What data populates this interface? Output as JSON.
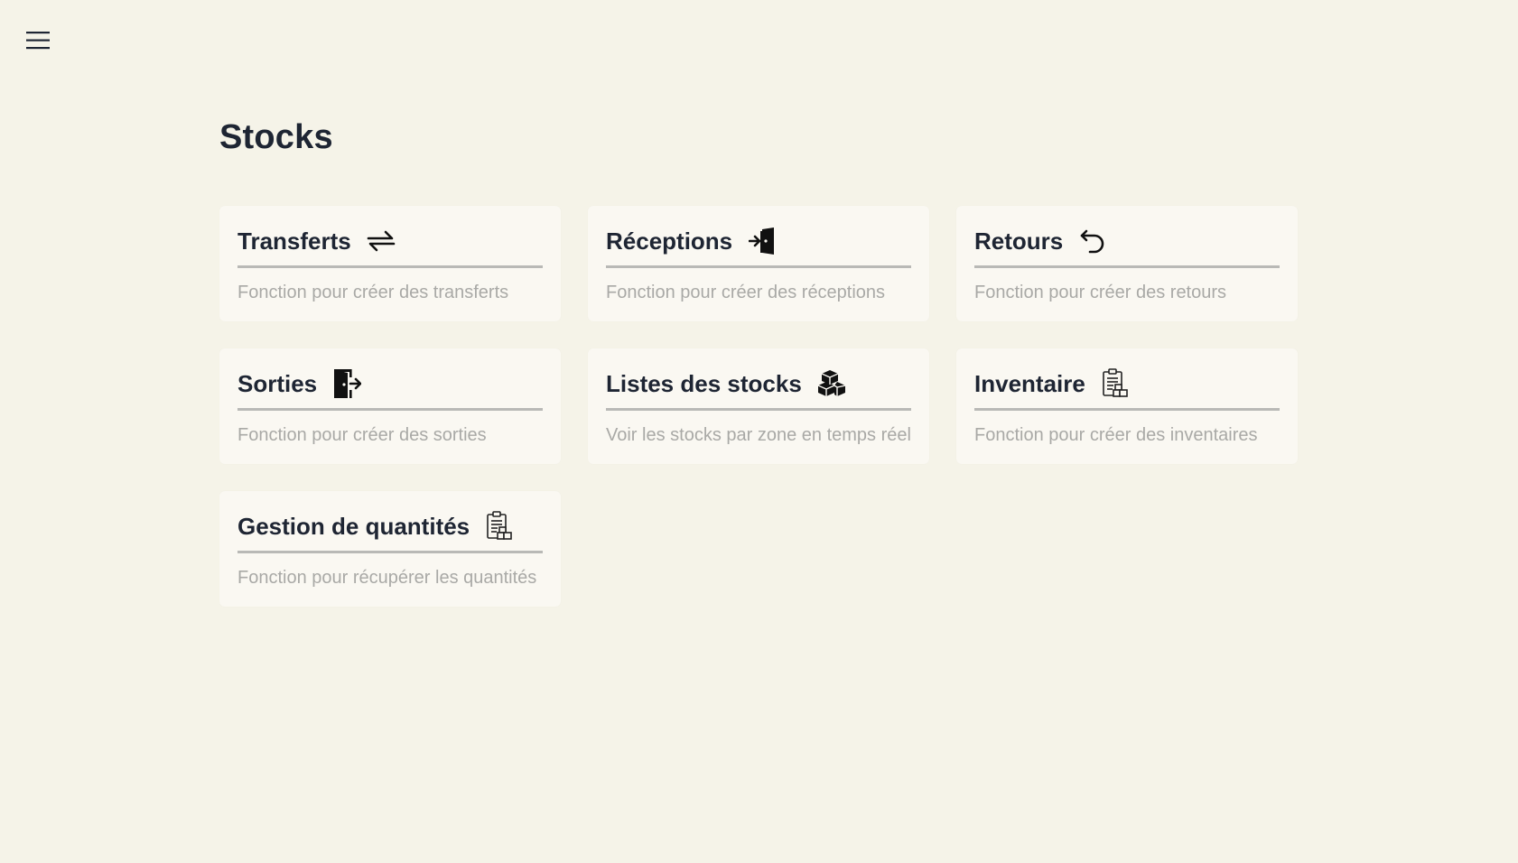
{
  "header": {
    "menu_icon": "hamburger-menu-icon"
  },
  "page": {
    "title": "Stocks"
  },
  "cards": [
    {
      "title": "Transferts",
      "icon": "transfer-arrows-icon",
      "description": "Fonction pour créer des transferts"
    },
    {
      "title": "Réceptions",
      "icon": "door-enter-icon",
      "description": "Fonction pour créer des réceptions"
    },
    {
      "title": "Retours",
      "icon": "return-arrow-icon",
      "description": "Fonction pour créer des retours"
    },
    {
      "title": "Sorties",
      "icon": "door-exit-icon",
      "description": "Fonction pour créer des sorties"
    },
    {
      "title": "Listes des stocks",
      "icon": "boxes-stack-icon",
      "description": "Voir les stocks par zone en temps réel"
    },
    {
      "title": "Inventaire",
      "icon": "clipboard-boxes-icon",
      "description": "Fonction pour créer des inventaires"
    },
    {
      "title": "Gestion de quantités",
      "icon": "clipboard-boxes-icon",
      "description": "Fonction pour récupérer les quantités"
    }
  ],
  "colors": {
    "background": "#f5f3e8",
    "card_background": "#faf8f2",
    "title_text": "#1e2533",
    "description_text": "#a9a9a6",
    "divider": "#b9b9b6"
  }
}
